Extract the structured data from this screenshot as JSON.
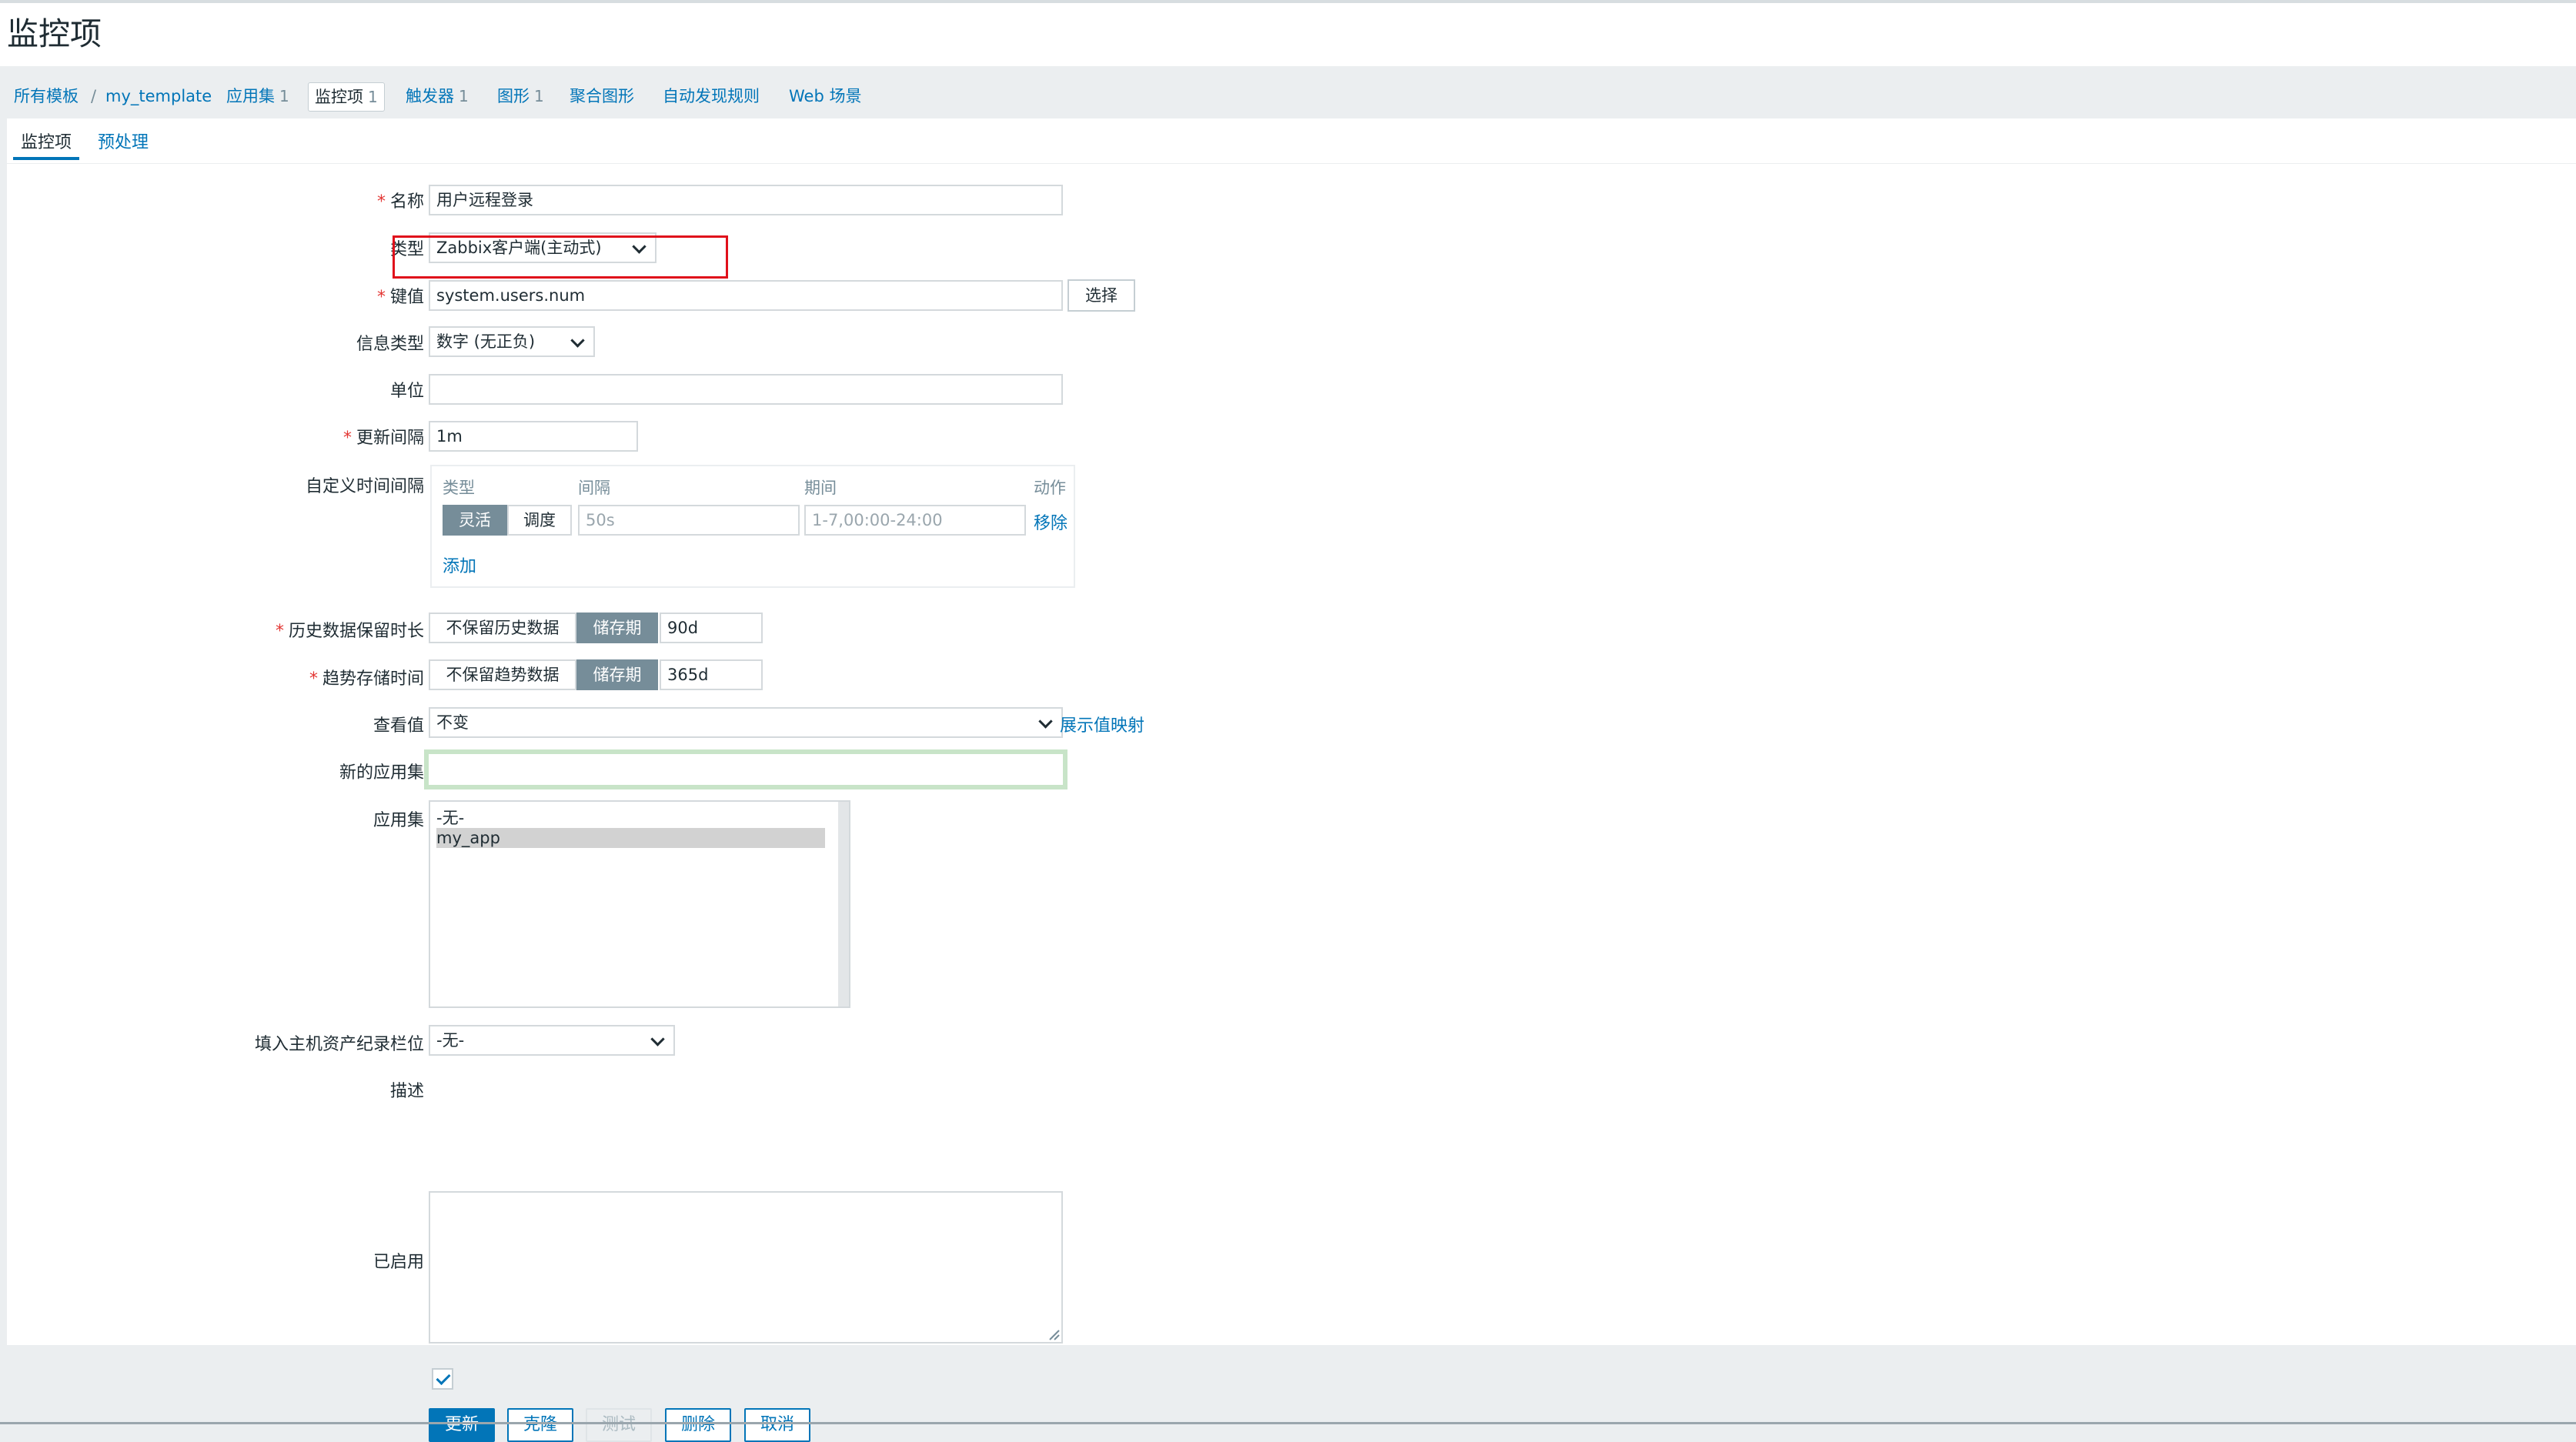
{
  "page": {
    "title": "监控项"
  },
  "breadcrumb": {
    "all_templates": "所有模板",
    "separator": "/",
    "template": "my_template",
    "items": [
      {
        "label": "应用集",
        "count": "1"
      },
      {
        "label": "监控项",
        "count": "1"
      },
      {
        "label": "触发器",
        "count": "1"
      },
      {
        "label": "图形",
        "count": "1"
      },
      {
        "label": "聚合图形",
        "count": ""
      },
      {
        "label": "自动发现规则",
        "count": ""
      },
      {
        "label": "Web 场景",
        "count": ""
      }
    ]
  },
  "tabs": [
    {
      "label": "监控项"
    },
    {
      "label": "预处理"
    }
  ],
  "form": {
    "name": {
      "label": "名称",
      "value": "用户远程登录"
    },
    "type": {
      "label": "类型",
      "value": "Zabbix客户端(主动式)"
    },
    "key": {
      "label": "键值",
      "value": "system.users.num",
      "select_button": "选择"
    },
    "info_type": {
      "label": "信息类型",
      "value": "数字 (无正负)"
    },
    "units": {
      "label": "单位",
      "value": ""
    },
    "update_interval": {
      "label": "更新间隔",
      "value": "1m"
    },
    "custom_intervals": {
      "label": "自定义时间间隔",
      "headers": {
        "type": "类型",
        "interval": "间隔",
        "period": "期间",
        "action": "动作"
      },
      "row": {
        "mode_flexible": "灵活",
        "mode_scheduling": "调度",
        "interval_placeholder": "50s",
        "period_placeholder": "1-7,00:00-24:00",
        "remove": "移除"
      },
      "add": "添加"
    },
    "history": {
      "label": "历史数据保留时长",
      "off": "不保留历史数据",
      "on": "储存期",
      "value": "90d"
    },
    "trends": {
      "label": "趋势存储时间",
      "off": "不保留趋势数据",
      "on": "储存期",
      "value": "365d"
    },
    "show_value": {
      "label": "查看值",
      "value": "不变",
      "link": "展示值映射"
    },
    "new_application": {
      "label": "新的应用集",
      "value": ""
    },
    "applications": {
      "label": "应用集",
      "options": [
        "-无-",
        "my_app"
      ]
    },
    "inventory": {
      "label": "填入主机资产纪录栏位",
      "value": "-无-"
    },
    "description": {
      "label": "描述",
      "value": ""
    },
    "enabled": {
      "label": "已启用",
      "checked": true
    }
  },
  "buttons": {
    "update": "更新",
    "clone": "克隆",
    "test": "测试",
    "delete": "删除",
    "cancel": "取消"
  },
  "colors": {
    "accent": "#0275b8",
    "required": "#e33734",
    "annotation": "#e0101b",
    "focus_border": "#c8e4c8"
  }
}
